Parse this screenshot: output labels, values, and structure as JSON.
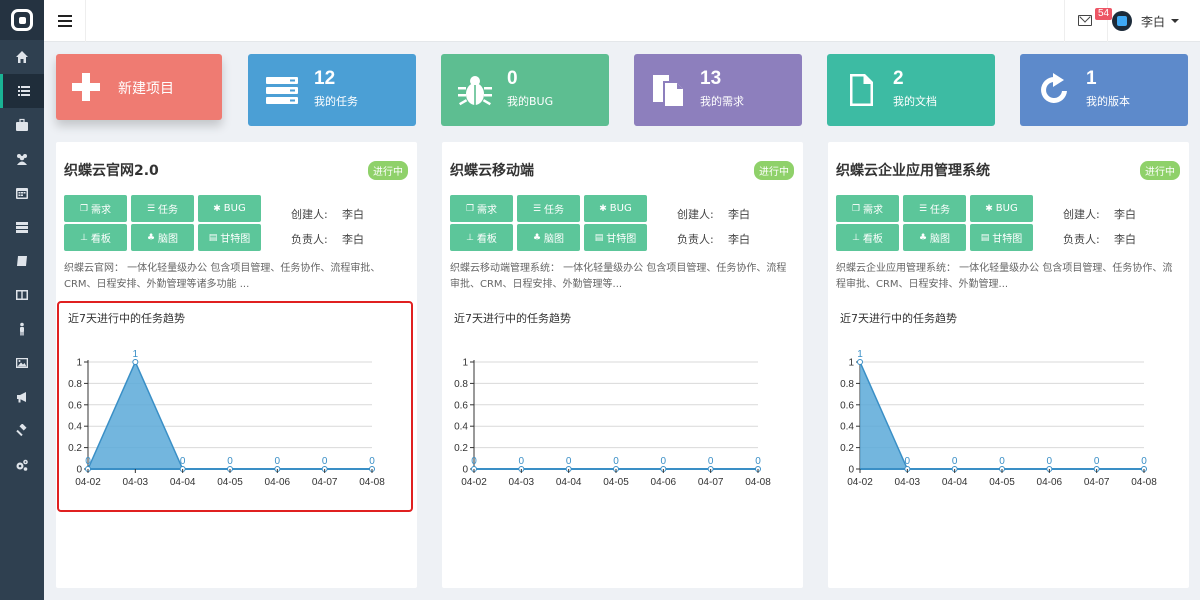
{
  "topbar": {
    "mail_count": "54",
    "user_name": "李白"
  },
  "tiles": {
    "new_project": "新建项目",
    "stats": [
      {
        "num": "12",
        "label": "我的任务",
        "color": "#4b9fd5",
        "icon": "server-icon"
      },
      {
        "num": "0",
        "label": "我的BUG",
        "color": "#5dbe91",
        "icon": "bug-icon"
      },
      {
        "num": "13",
        "label": "我的需求",
        "color": "#8d7fbd",
        "icon": "copy-icon"
      },
      {
        "num": "2",
        "label": "我的文档",
        "color": "#3dbba3",
        "icon": "file-icon"
      },
      {
        "num": "1",
        "label": "我的版本",
        "color": "#5d8acb",
        "icon": "refresh-icon"
      }
    ]
  },
  "buttons": {
    "req": "需求",
    "task": "任务",
    "bug": "BUG",
    "kanban": "看板",
    "mind": "脑图",
    "gantt": "甘特图"
  },
  "labels": {
    "creator": "创建人:",
    "owner": "负责人:",
    "trend_title": "近7天进行中的任务趋势"
  },
  "projects": [
    {
      "title": "织蝶云官网2.0",
      "status": "进行中",
      "creator": "李白",
      "owner": "李白",
      "desc": "织蝶云官网：  一体化轻量级办公 包含项目管理、任务协作、流程审批、CRM、日程安排、外勤管理等诸多功能 ..."
    },
    {
      "title": "织蝶云移动端",
      "status": "进行中",
      "creator": "李白",
      "owner": "李白",
      "desc": "织蝶云移动端管理系统：  一体化轻量级办公 包含项目管理、任务协作、流程审批、CRM、日程安排、外勤管理等..."
    },
    {
      "title": "织蝶云企业应用管理系统",
      "status": "进行中",
      "creator": "李白",
      "owner": "李白",
      "desc": "织蝶云企业应用管理系统：  一体化轻量级办公 包含项目管理、任务协作、流程审批、CRM、日程安排、外勤管理..."
    }
  ],
  "chart_data": [
    {
      "type": "area",
      "title": "近7天进行中的任务趋势",
      "categories": [
        "04-02",
        "04-03",
        "04-04",
        "04-05",
        "04-06",
        "04-07",
        "04-08"
      ],
      "values": [
        0,
        1,
        0,
        0,
        0,
        0,
        0
      ],
      "yticks": [
        "0",
        "0.2",
        "0.4",
        "0.6",
        "0.8",
        "1"
      ],
      "ylim": [
        0,
        1
      ]
    },
    {
      "type": "area",
      "title": "近7天进行中的任务趋势",
      "categories": [
        "04-02",
        "04-03",
        "04-04",
        "04-05",
        "04-06",
        "04-07",
        "04-08"
      ],
      "values": [
        0,
        0,
        0,
        0,
        0,
        0,
        0
      ],
      "yticks": [
        "0",
        "0.2",
        "0.4",
        "0.6",
        "0.8",
        "1"
      ],
      "ylim": [
        0,
        1
      ]
    },
    {
      "type": "area",
      "title": "近7天进行中的任务趋势",
      "categories": [
        "04-02",
        "04-03",
        "04-04",
        "04-05",
        "04-06",
        "04-07",
        "04-08"
      ],
      "values": [
        1,
        0,
        0,
        0,
        0,
        0,
        0
      ],
      "yticks": [
        "0",
        "0.2",
        "0.4",
        "0.6",
        "0.8",
        "1"
      ],
      "ylim": [
        0,
        1
      ]
    }
  ]
}
